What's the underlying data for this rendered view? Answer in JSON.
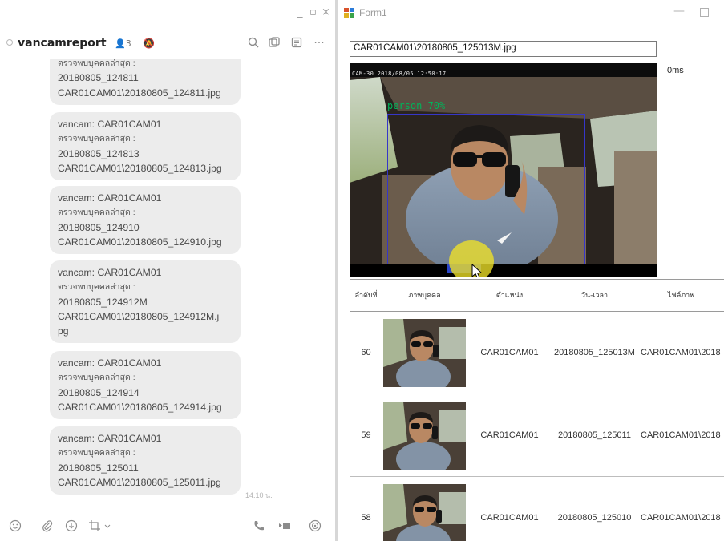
{
  "colors": {
    "chat_bubble": "#ececec",
    "detection_box": "#3636c8",
    "detection_label": "#00b35a",
    "cursor_highlight": "#f0e228",
    "accent_blue": "#2a46c8"
  },
  "chat": {
    "name": "vancamreport",
    "member_count": "3",
    "time": "14.10 น.",
    "messages": [
      {
        "lines": [
          "ตรวจพบบุคคลล่าสุด :",
          "20180805_124811",
          "CAR01CAM01\\20180805_124811.jpg"
        ]
      },
      {
        "lines": [
          "vancam: CAR01CAM01",
          "ตรวจพบบุคคลล่าสุด :",
          "20180805_124813",
          "CAR01CAM01\\20180805_124813.jpg"
        ]
      },
      {
        "lines": [
          "vancam: CAR01CAM01",
          "ตรวจพบบุคคลล่าสุด :",
          "20180805_124910",
          "CAR01CAM01\\20180805_124910.jpg"
        ]
      },
      {
        "lines": [
          "vancam: CAR01CAM01",
          "ตรวจพบบุคคลล่าสุด :",
          "20180805_124912M",
          "CAR01CAM01\\20180805_124912M.j",
          "pg"
        ]
      },
      {
        "lines": [
          "vancam: CAR01CAM01",
          "ตรวจพบบุคคลล่าสุด :",
          "20180805_124914",
          "CAR01CAM01\\20180805_124914.jpg"
        ]
      },
      {
        "lines": [
          "vancam: CAR01CAM01",
          "ตรวจพบบุคคลล่าสุด :",
          "20180805_125011",
          "CAR01CAM01\\20180805_125011.jpg"
        ]
      }
    ]
  },
  "form": {
    "title": "Form1",
    "path_text": "CAR01CAM01\\20180805_125013M.jpg",
    "timing": "0ms",
    "camera_overlay": "CAM-30 2018/08/05 12:50:17",
    "detection_label": "person 70%",
    "grid": {
      "headers": [
        "ลำดับที่",
        "ภาพบุคคล",
        "ตำแหน่ง",
        "วัน-เวลา",
        "ไฟล์ภาพ"
      ],
      "rows": [
        {
          "index": "60",
          "location": "CAR01CAM01",
          "datetime": "20180805_125013M",
          "file": "CAR01CAM01\\2018"
        },
        {
          "index": "59",
          "location": "CAR01CAM01",
          "datetime": "20180805_125011",
          "file": "CAR01CAM01\\2018"
        },
        {
          "index": "58",
          "location": "CAR01CAM01",
          "datetime": "20180805_125010",
          "file": "CAR01CAM01\\2018"
        }
      ]
    }
  }
}
